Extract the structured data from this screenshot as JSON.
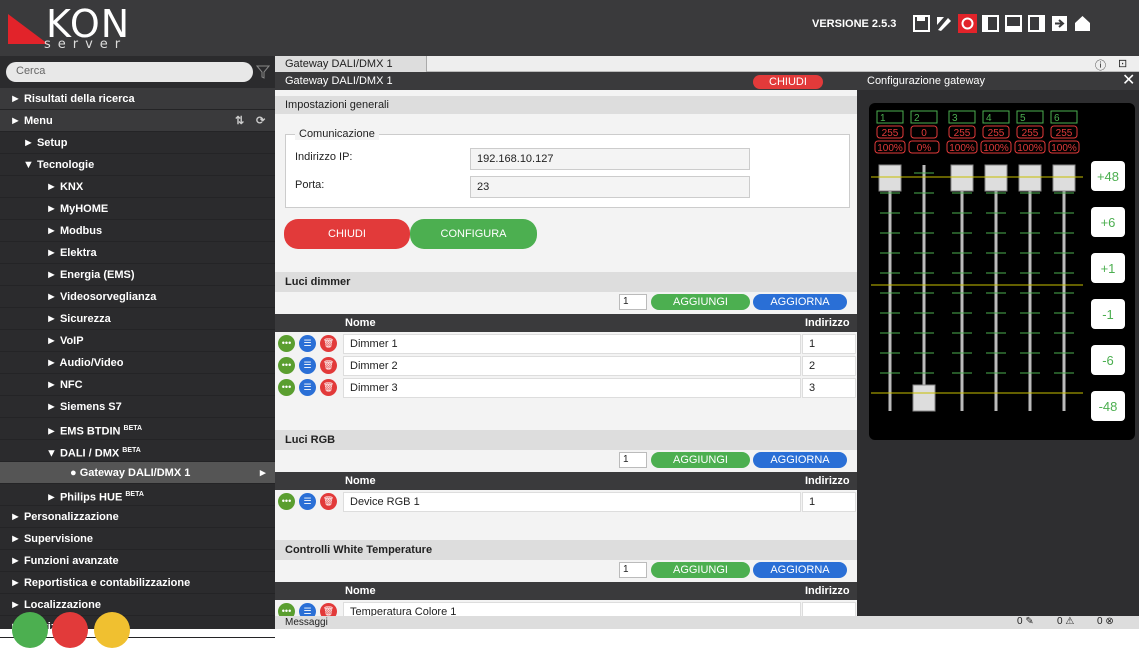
{
  "header": {
    "logo_text": "KON",
    "logo_sub": "server",
    "version": "VERSIONE 2.5.3"
  },
  "sidebar": {
    "search_placeholder": "Cerca",
    "items": [
      {
        "label": "► Risultati della ricerca"
      },
      {
        "label": "► Menu"
      },
      {
        "label": "► Setup"
      },
      {
        "label": "▼ Tecnologie"
      },
      {
        "label": "► KNX"
      },
      {
        "label": "► MyHOME"
      },
      {
        "label": "► Modbus"
      },
      {
        "label": "► Elektra"
      },
      {
        "label": "► Energia (EMS)"
      },
      {
        "label": "► Videosorveglianza"
      },
      {
        "label": "► Sicurezza"
      },
      {
        "label": "► VoIP"
      },
      {
        "label": "► Audio/Video"
      },
      {
        "label": "► NFC"
      },
      {
        "label": "► Siemens S7"
      },
      {
        "label": "► EMS BTDIN"
      },
      {
        "label": "▼ DALI / DMX"
      },
      {
        "label": "● Gateway DALI/DMX 1"
      },
      {
        "label": "► Philips HUE"
      },
      {
        "label": "► Personalizzazione"
      },
      {
        "label": "► Supervisione"
      },
      {
        "label": "► Funzioni avanzate"
      },
      {
        "label": "► Reportistica e contabilizzazione"
      },
      {
        "label": "► Localizzazione"
      },
      {
        "label": "► Servizi"
      }
    ],
    "beta": "BETA"
  },
  "tab": {
    "label": "Gateway DALI/DMX 1"
  },
  "main": {
    "title": "Gateway DALI/DMX 1",
    "close": "CHIUDI",
    "general": "Impostazioni generali",
    "comm": "Comunicazione",
    "ip_label": "Indirizzo IP:",
    "ip_value": "192.168.10.127",
    "port_label": "Porta:",
    "port_value": "23",
    "btn_close": "CHIUDI",
    "btn_config": "CONFIGURA",
    "add": "AGGIUNGI",
    "refresh": "AGGIORNA",
    "qty": "1",
    "col_name": "Nome",
    "col_addr": "Indirizzo",
    "sections": [
      {
        "title": "Luci dimmer",
        "rows": [
          {
            "name": "Dimmer 1",
            "addr": "1"
          },
          {
            "name": "Dimmer 2",
            "addr": "2"
          },
          {
            "name": "Dimmer 3",
            "addr": "3"
          }
        ]
      },
      {
        "title": "Luci RGB",
        "rows": [
          {
            "name": "Device RGB 1",
            "addr": "1"
          }
        ]
      },
      {
        "title": "Controlli White Temperature",
        "rows": [
          {
            "name": "Temperatura Colore 1",
            "addr": ""
          }
        ]
      }
    ]
  },
  "config": {
    "title": "Configurazione gateway",
    "channels": [
      {
        "ch": "1",
        "val": "255",
        "pct": "100%",
        "level": 1.0
      },
      {
        "ch": "2",
        "val": "0",
        "pct": "0%",
        "level": 0.0
      },
      {
        "ch": "3",
        "val": "255",
        "pct": "100%",
        "level": 1.0
      },
      {
        "ch": "4",
        "val": "255",
        "pct": "100%",
        "level": 1.0
      },
      {
        "ch": "5",
        "val": "255",
        "pct": "100%",
        "level": 1.0
      },
      {
        "ch": "6",
        "val": "255",
        "pct": "100%",
        "level": 1.0
      }
    ],
    "steps": [
      "+48",
      "+6",
      "+1",
      "-1",
      "-6",
      "-48"
    ]
  },
  "footer": {
    "messages": "Messaggi",
    "c1": "0",
    "c2": "0",
    "c3": "0"
  },
  "colors": {
    "red": "#e23a3a",
    "green": "#4caf50",
    "blue": "#2a6fd6"
  }
}
